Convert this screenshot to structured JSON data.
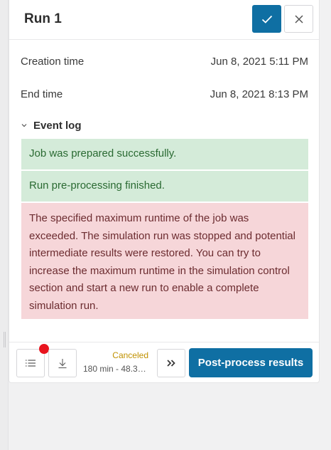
{
  "panel": {
    "title": "Run 1",
    "header_buttons": {
      "confirm_icon": "check-icon",
      "close_icon": "close-icon"
    }
  },
  "details": [
    {
      "label": "Creation time",
      "value": "Jun 8, 2021 5:11 PM"
    },
    {
      "label": "End time",
      "value": "Jun 8, 2021 8:13 PM"
    }
  ],
  "event_log": {
    "label": "Event log",
    "entries": [
      {
        "type": "success",
        "text": "Job was prepared successfully."
      },
      {
        "type": "success",
        "text": "Run pre-processing finished."
      },
      {
        "type": "error",
        "text": "The specified maximum runtime of the job was exceeded. The simulation run was stopped and potential intermediate results were restored. You can try to increase the maximum runtime in the simulation control section and start a new run to enable a complete simulation run."
      }
    ]
  },
  "footer": {
    "status": "Canceled",
    "runtime": "180 min - 48.3…",
    "primary_label": "Post-process results",
    "icons": [
      "list-icon",
      "download-icon",
      "double-chevron-right-icon"
    ]
  },
  "colors": {
    "accent": "#0f6fa3",
    "success_bg": "#d4ebd9",
    "error_bg": "#f6d6d9",
    "status_canceled": "#c09100",
    "notification": "#e8141e"
  }
}
